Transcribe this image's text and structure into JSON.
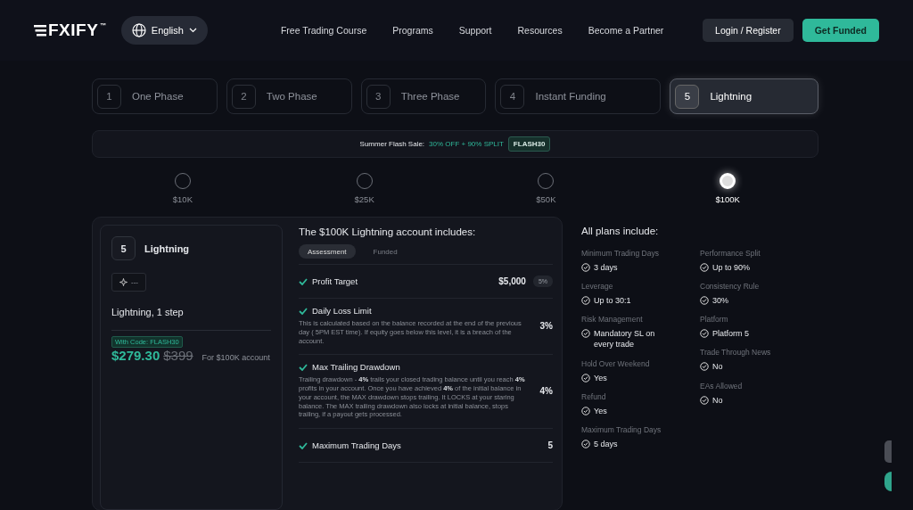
{
  "header": {
    "logo": "FXIFY",
    "logo_mark": "™",
    "language": "English",
    "nav": [
      "Free Trading Course",
      "Programs",
      "Support",
      "Resources",
      "Become a Partner"
    ],
    "login": "Login / Register",
    "cta": "Get Funded"
  },
  "program_tabs": [
    {
      "number": "1",
      "label": "One Phase",
      "selected": false
    },
    {
      "number": "2",
      "label": "Two Phase",
      "selected": false
    },
    {
      "number": "3",
      "label": "Three Phase",
      "selected": false
    },
    {
      "number": "4",
      "label": "Instant Funding",
      "selected": false
    },
    {
      "number": "5",
      "label": "Lightning",
      "selected": true
    }
  ],
  "sale_banner": {
    "label": "Summer Flash Sale:",
    "offer": "30% OFF + 90% SPLIT",
    "code": "FLASH30"
  },
  "sizes": [
    {
      "label": "$10K",
      "selected": false
    },
    {
      "label": "$25K",
      "selected": false
    },
    {
      "label": "$50K",
      "selected": false
    },
    {
      "label": "$100K",
      "selected": true
    }
  ],
  "plan_card": {
    "number": "5",
    "name": "Lightning",
    "chip": "---",
    "description": "Lightning, 1 step",
    "code_badge": "With Code: FLASH30",
    "price": "$279.30",
    "old_price": "$399",
    "price_note": "For $100K account"
  },
  "includes": {
    "title": "The $100K Lightning account includes:",
    "tabs": [
      {
        "label": "Assessment",
        "selected": true
      },
      {
        "label": "Funded",
        "selected": false
      }
    ],
    "rules": [
      {
        "title": "Profit Target",
        "value": "$5,000",
        "badge": "5%"
      },
      {
        "title": "Daily Loss Limit",
        "description": "This is calculated based on the balance recorded at the end of the previous day ( 5PM EST time). If equity goes below this level, it is a breach of the account.",
        "value": "3%"
      },
      {
        "title": "Max Trailing Drawdown",
        "description": "Trailing drawdown - **4%** trails your closed trading balance until you reach **4%** profits in your account. Once you have achieved **4%** of the initial balance in your account, the MAX drawdown stops trailing. It LOCKS at your staring balance. The MAX trailing drawdown also locks at initial balance, stops trailing, if a payout gets processed.",
        "value": "4%"
      },
      {
        "title": "Maximum Trading Days",
        "value": "5"
      }
    ]
  },
  "all_plans": {
    "title": "All plans include:",
    "columns": [
      [
        {
          "label": "Minimum Trading Days",
          "value": "3 days"
        },
        {
          "label": "Leverage",
          "value": "Up to 30:1"
        },
        {
          "label": "Risk Management",
          "value": "Mandatory SL on every trade"
        },
        {
          "label": "Hold Over Weekend",
          "value": "Yes"
        },
        {
          "label": "Refund",
          "value": "Yes"
        },
        {
          "label": "Maximum Trading Days",
          "value": "5 days"
        }
      ],
      [
        {
          "label": "Performance Split",
          "value": "Up to 90%"
        },
        {
          "label": "Consistency Rule",
          "value": "30%"
        },
        {
          "label": "Platform",
          "value": "Platform 5"
        },
        {
          "label": "Trade Through News",
          "value": "No"
        },
        {
          "label": "EAs Allowed",
          "value": "No"
        }
      ]
    ]
  }
}
